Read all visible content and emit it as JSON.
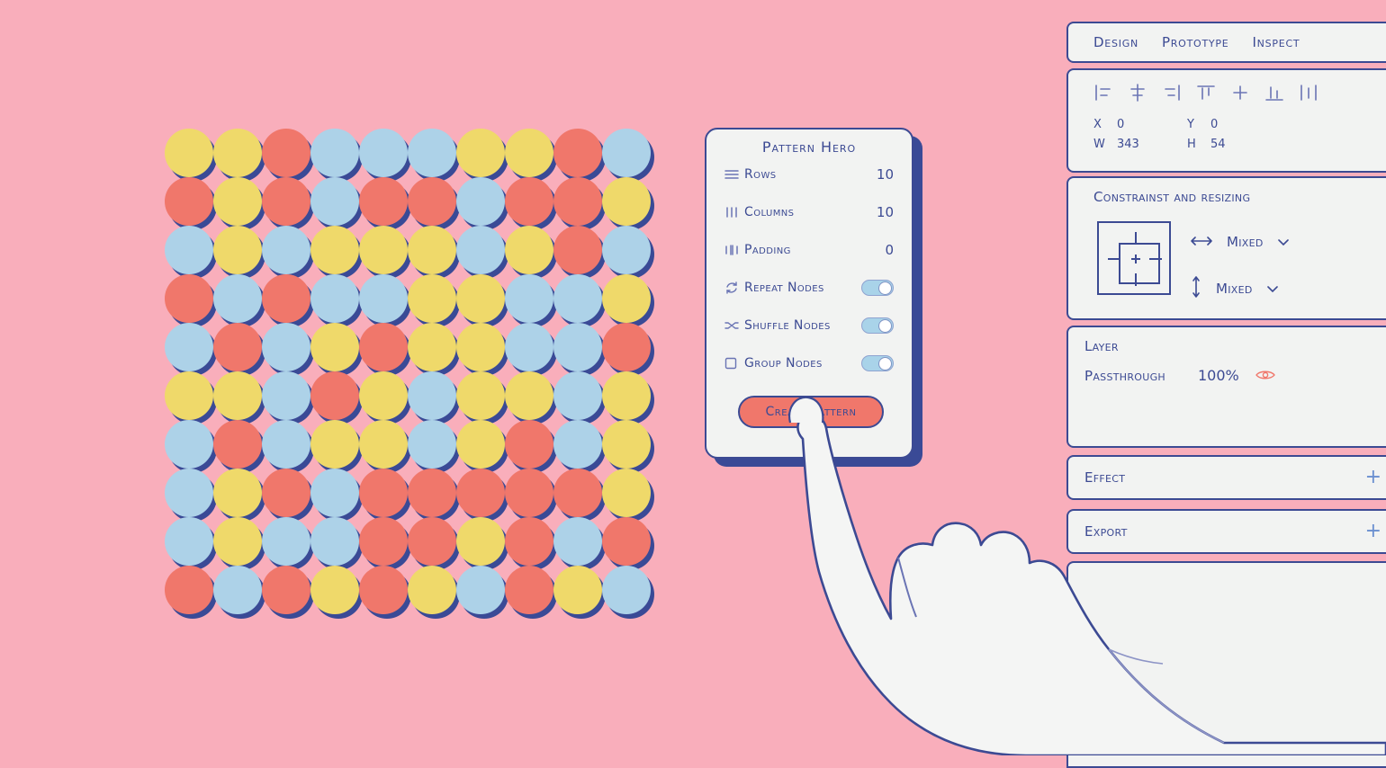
{
  "canvas": {
    "background_color": "#f9aebb",
    "shadow_color": "#3a4a96",
    "ink_color": "#3c4a93"
  },
  "pattern_grid": {
    "rows": 10,
    "columns": 10,
    "palette": {
      "y": "#efd96a",
      "r": "#f0776b",
      "b": "#add2e8"
    },
    "cells": [
      [
        "y",
        "y",
        "r",
        "b",
        "b",
        "b",
        "y",
        "y",
        "r",
        "b"
      ],
      [
        "r",
        "y",
        "r",
        "b",
        "r",
        "r",
        "b",
        "r",
        "r",
        "y"
      ],
      [
        "b",
        "y",
        "b",
        "y",
        "y",
        "y",
        "b",
        "y",
        "r",
        "b"
      ],
      [
        "r",
        "b",
        "r",
        "b",
        "b",
        "y",
        "y",
        "b",
        "b",
        "y"
      ],
      [
        "b",
        "r",
        "b",
        "y",
        "r",
        "y",
        "y",
        "b",
        "b",
        "r"
      ],
      [
        "y",
        "y",
        "b",
        "r",
        "y",
        "b",
        "y",
        "y",
        "b",
        "y"
      ],
      [
        "b",
        "r",
        "b",
        "y",
        "y",
        "b",
        "y",
        "r",
        "b",
        "y"
      ],
      [
        "b",
        "y",
        "r",
        "b",
        "r",
        "r",
        "r",
        "r",
        "r",
        "y"
      ],
      [
        "b",
        "y",
        "b",
        "b",
        "r",
        "r",
        "y",
        "r",
        "b",
        "r"
      ],
      [
        "r",
        "b",
        "r",
        "y",
        "r",
        "y",
        "b",
        "r",
        "y",
        "b"
      ]
    ]
  },
  "dialog": {
    "title": "Pattern Hero",
    "rows": [
      {
        "icon": "rows-icon",
        "label": "Rows",
        "value": "10",
        "control": "value"
      },
      {
        "icon": "columns-icon",
        "label": "Columns",
        "value": "10",
        "control": "value"
      },
      {
        "icon": "padding-icon",
        "label": "Padding",
        "value": "0",
        "control": "value"
      },
      {
        "icon": "repeat-icon",
        "label": "Repeat Nodes",
        "value": "on",
        "control": "toggle"
      },
      {
        "icon": "shuffle-icon",
        "label": "Shuffle Nodes",
        "value": "on",
        "control": "toggle"
      },
      {
        "icon": "group-icon",
        "label": "Group Nodes",
        "value": "on",
        "control": "toggle"
      }
    ],
    "primary_button": {
      "label": "Create Pattern",
      "color": "#f0776b"
    }
  },
  "inspector": {
    "tabs": [
      {
        "label": "Design",
        "selected": true
      },
      {
        "label": "Prototype",
        "selected": false
      },
      {
        "label": "Inspect",
        "selected": false
      }
    ],
    "align_icons": [
      "align-left-icon",
      "align-horizontal-center-icon",
      "align-right-icon",
      "align-top-icon",
      "align-vertical-center-icon",
      "align-bottom-icon",
      "distribute-horizontal-icon"
    ],
    "dimensions": {
      "x_label": "X",
      "x_value": "0",
      "y_label": "Y",
      "y_value": "0",
      "w_label": "W",
      "w_value": "343",
      "h_label": "H",
      "h_value": "54"
    },
    "constraints": {
      "title": "Constrainst and resizing",
      "horizontal_icon": "horizontal-arrows-icon",
      "horizontal_value": "Mixed",
      "vertical_icon": "vertical-arrows-icon",
      "vertical_value": "Mixed"
    },
    "layer": {
      "title": "Layer",
      "blend_mode": "Passthrough",
      "opacity": "100%",
      "visibility_icon": "eye-icon",
      "eye_color": "#f0776b"
    },
    "effect": {
      "title": "Effect",
      "add_icon": "plus-icon"
    },
    "export": {
      "title": "Export",
      "add_icon": "plus-icon"
    }
  },
  "cursor": {
    "type": "hand-pointing-icon",
    "target": "Create Pattern"
  }
}
